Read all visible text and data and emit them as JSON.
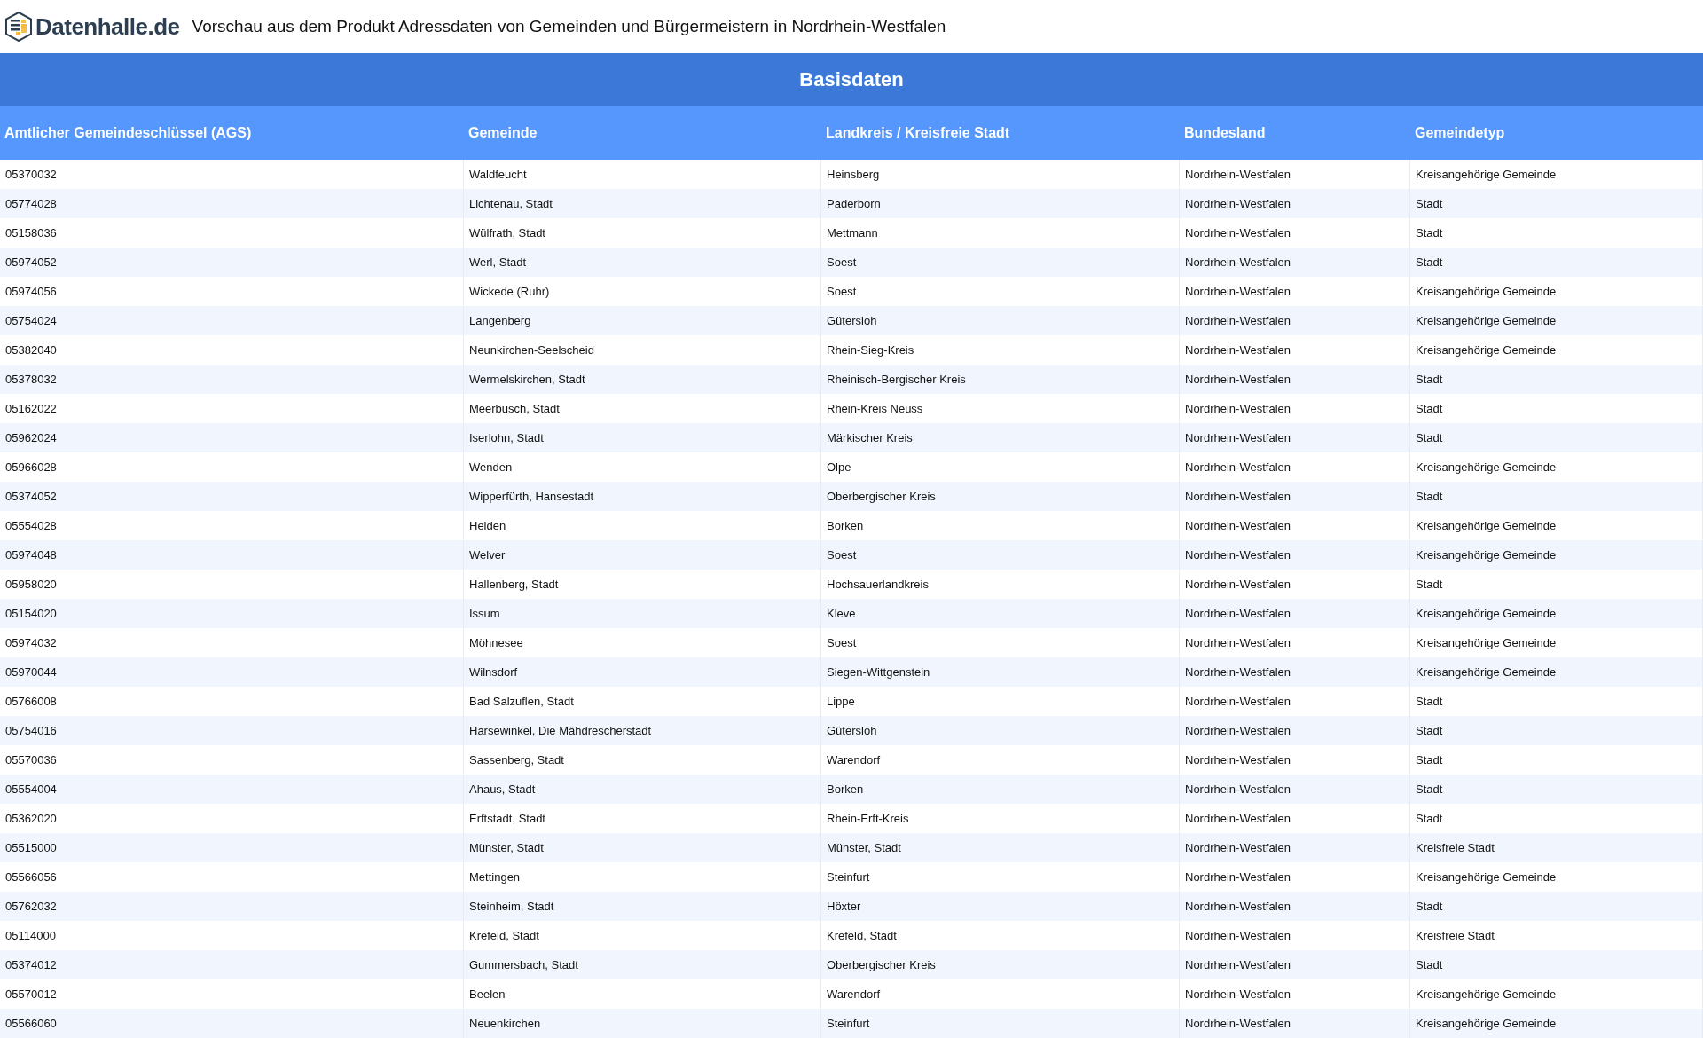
{
  "header": {
    "logo_text": "Datenhalle.de",
    "title": "Vorschau aus dem Produkt Adressdaten von Gemeinden und Bürgermeistern in Nordrhein-Westfalen"
  },
  "section_title": "Basisdaten",
  "table": {
    "columns": [
      "Amtlicher Gemeindeschlüssel (AGS)",
      "Gemeinde",
      "Landkreis / Kreisfreie Stadt",
      "Bundesland",
      "Gemeindetyp"
    ],
    "rows": [
      [
        "05370032",
        "Waldfeucht",
        "Heinsberg",
        "Nordrhein-Westfalen",
        "Kreisangehörige Gemeinde"
      ],
      [
        "05774028",
        "Lichtenau, Stadt",
        "Paderborn",
        "Nordrhein-Westfalen",
        "Stadt"
      ],
      [
        "05158036",
        "Wülfrath, Stadt",
        "Mettmann",
        "Nordrhein-Westfalen",
        "Stadt"
      ],
      [
        "05974052",
        "Werl, Stadt",
        "Soest",
        "Nordrhein-Westfalen",
        "Stadt"
      ],
      [
        "05974056",
        "Wickede (Ruhr)",
        "Soest",
        "Nordrhein-Westfalen",
        "Kreisangehörige Gemeinde"
      ],
      [
        "05754024",
        "Langenberg",
        "Gütersloh",
        "Nordrhein-Westfalen",
        "Kreisangehörige Gemeinde"
      ],
      [
        "05382040",
        "Neunkirchen-Seelscheid",
        "Rhein-Sieg-Kreis",
        "Nordrhein-Westfalen",
        "Kreisangehörige Gemeinde"
      ],
      [
        "05378032",
        "Wermelskirchen, Stadt",
        "Rheinisch-Bergischer Kreis",
        "Nordrhein-Westfalen",
        "Stadt"
      ],
      [
        "05162022",
        "Meerbusch, Stadt",
        "Rhein-Kreis Neuss",
        "Nordrhein-Westfalen",
        "Stadt"
      ],
      [
        "05962024",
        "Iserlohn, Stadt",
        "Märkischer Kreis",
        "Nordrhein-Westfalen",
        "Stadt"
      ],
      [
        "05966028",
        "Wenden",
        "Olpe",
        "Nordrhein-Westfalen",
        "Kreisangehörige Gemeinde"
      ],
      [
        "05374052",
        "Wipperfürth, Hansestadt",
        "Oberbergischer Kreis",
        "Nordrhein-Westfalen",
        "Stadt"
      ],
      [
        "05554028",
        "Heiden",
        "Borken",
        "Nordrhein-Westfalen",
        "Kreisangehörige Gemeinde"
      ],
      [
        "05974048",
        "Welver",
        "Soest",
        "Nordrhein-Westfalen",
        "Kreisangehörige Gemeinde"
      ],
      [
        "05958020",
        "Hallenberg, Stadt",
        "Hochsauerlandkreis",
        "Nordrhein-Westfalen",
        "Stadt"
      ],
      [
        "05154020",
        "Issum",
        "Kleve",
        "Nordrhein-Westfalen",
        "Kreisangehörige Gemeinde"
      ],
      [
        "05974032",
        "Möhnesee",
        "Soest",
        "Nordrhein-Westfalen",
        "Kreisangehörige Gemeinde"
      ],
      [
        "05970044",
        "Wilnsdorf",
        "Siegen-Wittgenstein",
        "Nordrhein-Westfalen",
        "Kreisangehörige Gemeinde"
      ],
      [
        "05766008",
        "Bad Salzuflen, Stadt",
        "Lippe",
        "Nordrhein-Westfalen",
        "Stadt"
      ],
      [
        "05754016",
        "Harsewinkel, Die Mähdrescherstadt",
        "Gütersloh",
        "Nordrhein-Westfalen",
        "Stadt"
      ],
      [
        "05570036",
        "Sassenberg, Stadt",
        "Warendorf",
        "Nordrhein-Westfalen",
        "Stadt"
      ],
      [
        "05554004",
        "Ahaus, Stadt",
        "Borken",
        "Nordrhein-Westfalen",
        "Stadt"
      ],
      [
        "05362020",
        "Erftstadt, Stadt",
        "Rhein-Erft-Kreis",
        "Nordrhein-Westfalen",
        "Stadt"
      ],
      [
        "05515000",
        "Münster, Stadt",
        "Münster, Stadt",
        "Nordrhein-Westfalen",
        "Kreisfreie Stadt"
      ],
      [
        "05566056",
        "Mettingen",
        "Steinfurt",
        "Nordrhein-Westfalen",
        "Kreisangehörige Gemeinde"
      ],
      [
        "05762032",
        "Steinheim, Stadt",
        "Höxter",
        "Nordrhein-Westfalen",
        "Stadt"
      ],
      [
        "05114000",
        "Krefeld, Stadt",
        "Krefeld, Stadt",
        "Nordrhein-Westfalen",
        "Kreisfreie Stadt"
      ],
      [
        "05374012",
        "Gummersbach, Stadt",
        "Oberbergischer Kreis",
        "Nordrhein-Westfalen",
        "Stadt"
      ],
      [
        "05570012",
        "Beelen",
        "Warendorf",
        "Nordrhein-Westfalen",
        "Kreisangehörige Gemeinde"
      ],
      [
        "05566060",
        "Neuenkirchen",
        "Steinfurt",
        "Nordrhein-Westfalen",
        "Kreisangehörige Gemeinde"
      ]
    ]
  }
}
